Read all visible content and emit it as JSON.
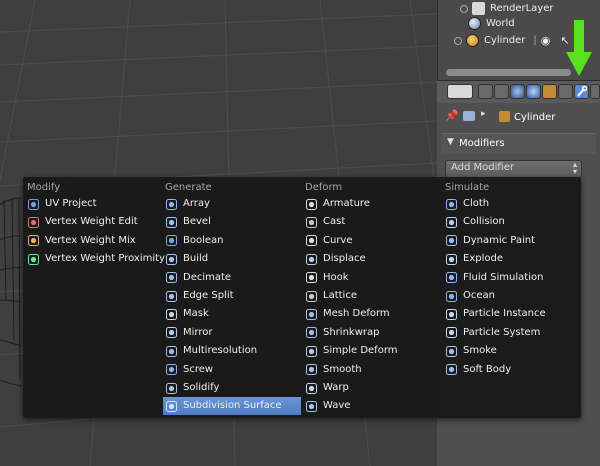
{
  "outliner": {
    "items": [
      {
        "label": "RenderLayer"
      },
      {
        "label": "World"
      },
      {
        "label": "Cylinder"
      }
    ]
  },
  "properties": {
    "context_object": "Cylinder",
    "panel_title": "Modifiers",
    "add_modifier_label": "Add Modifier"
  },
  "menu": {
    "columns": [
      {
        "heading": "Modify",
        "items": [
          {
            "label": "UV Project",
            "icon": "uv-project-icon"
          },
          {
            "label": "Vertex Weight Edit",
            "icon": "vertex-weight-edit-icon"
          },
          {
            "label": "Vertex Weight Mix",
            "icon": "vertex-weight-mix-icon"
          },
          {
            "label": "Vertex Weight Proximity",
            "icon": "vertex-weight-proximity-icon"
          }
        ]
      },
      {
        "heading": "Generate",
        "items": [
          {
            "label": "Array",
            "icon": "array-icon"
          },
          {
            "label": "Bevel",
            "icon": "bevel-icon"
          },
          {
            "label": "Boolean",
            "icon": "boolean-icon"
          },
          {
            "label": "Build",
            "icon": "build-icon"
          },
          {
            "label": "Decimate",
            "icon": "decimate-icon"
          },
          {
            "label": "Edge Split",
            "icon": "edge-split-icon"
          },
          {
            "label": "Mask",
            "icon": "mask-icon"
          },
          {
            "label": "Mirror",
            "icon": "mirror-icon"
          },
          {
            "label": "Multiresolution",
            "icon": "multiresolution-icon"
          },
          {
            "label": "Screw",
            "icon": "screw-icon"
          },
          {
            "label": "Solidify",
            "icon": "solidify-icon"
          },
          {
            "label": "Subdivision Surface",
            "icon": "subdivision-surface-icon",
            "selected": true
          }
        ]
      },
      {
        "heading": "Deform",
        "items": [
          {
            "label": "Armature",
            "icon": "armature-icon"
          },
          {
            "label": "Cast",
            "icon": "cast-icon"
          },
          {
            "label": "Curve",
            "icon": "curve-icon"
          },
          {
            "label": "Displace",
            "icon": "displace-icon"
          },
          {
            "label": "Hook",
            "icon": "hook-icon"
          },
          {
            "label": "Lattice",
            "icon": "lattice-icon"
          },
          {
            "label": "Mesh Deform",
            "icon": "mesh-deform-icon"
          },
          {
            "label": "Shrinkwrap",
            "icon": "shrinkwrap-icon"
          },
          {
            "label": "Simple Deform",
            "icon": "simple-deform-icon"
          },
          {
            "label": "Smooth",
            "icon": "smooth-icon"
          },
          {
            "label": "Warp",
            "icon": "warp-icon"
          },
          {
            "label": "Wave",
            "icon": "wave-icon"
          }
        ]
      },
      {
        "heading": "Simulate",
        "items": [
          {
            "label": "Cloth",
            "icon": "cloth-icon"
          },
          {
            "label": "Collision",
            "icon": "collision-icon"
          },
          {
            "label": "Dynamic Paint",
            "icon": "dynamic-paint-icon"
          },
          {
            "label": "Explode",
            "icon": "explode-icon"
          },
          {
            "label": "Fluid Simulation",
            "icon": "fluid-simulation-icon"
          },
          {
            "label": "Ocean",
            "icon": "ocean-icon"
          },
          {
            "label": "Particle Instance",
            "icon": "particle-instance-icon"
          },
          {
            "label": "Particle System",
            "icon": "particle-system-icon"
          },
          {
            "label": "Smoke",
            "icon": "smoke-icon"
          },
          {
            "label": "Soft Body",
            "icon": "soft-body-icon"
          }
        ]
      }
    ]
  },
  "colors": {
    "selected_item": "#5a86cf",
    "annotation_arrow": "#59e01e",
    "active_tab": "#5b8ad3"
  }
}
